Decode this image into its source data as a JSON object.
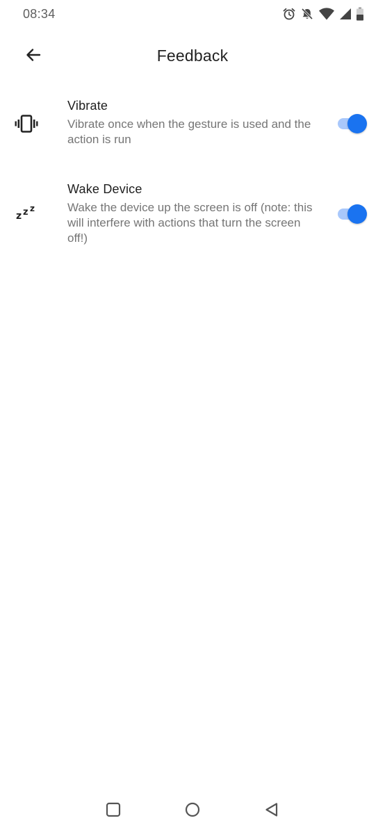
{
  "status_bar": {
    "time": "08:34",
    "icons": [
      "alarm-icon",
      "bell-off-icon",
      "wifi-icon",
      "signal-icon",
      "battery-icon"
    ]
  },
  "app_bar": {
    "title": "Feedback",
    "back_icon": "arrow-back-icon"
  },
  "preferences": [
    {
      "icon": "vibrate-icon",
      "title": "Vibrate",
      "summary": "Vibrate once when the gesture is used and the action is run",
      "enabled": true
    },
    {
      "icon": "zzz-sleep-icon",
      "title": "Wake Device",
      "summary": "Wake the device up the screen is off (note: this will interfere with actions that turn the screen off!)",
      "enabled": true
    }
  ],
  "nav_bar": {
    "buttons": [
      "recents-square-icon",
      "home-circle-icon",
      "back-triangle-icon"
    ]
  },
  "colors": {
    "accent": "#1a73f0",
    "track_on": "#a9c8fb",
    "title_text": "#202020",
    "summary_text": "#757575"
  }
}
